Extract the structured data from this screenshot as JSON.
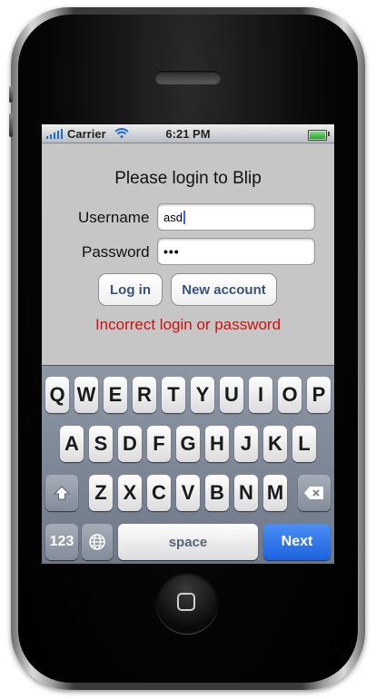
{
  "status": {
    "carrier": "Carrier",
    "time": "6:21 PM"
  },
  "login": {
    "title": "Please login to Blip",
    "username_label": "Username",
    "username_value": "asd",
    "password_label": "Password",
    "password_value": "•••",
    "login_button": "Log in",
    "new_account_button": "New account",
    "error_message": "Incorrect login or password"
  },
  "keyboard": {
    "row1": [
      "Q",
      "W",
      "E",
      "R",
      "T",
      "Y",
      "U",
      "I",
      "O",
      "P"
    ],
    "row2": [
      "A",
      "S",
      "D",
      "F",
      "G",
      "H",
      "J",
      "K",
      "L"
    ],
    "row3": [
      "Z",
      "X",
      "C",
      "V",
      "B",
      "N",
      "M"
    ],
    "numbers_key": "123",
    "space_key": "space",
    "next_key": "Next"
  },
  "colors": {
    "error": "#d01010",
    "next_key": "#1c63e0",
    "button_text": "#38547f"
  }
}
